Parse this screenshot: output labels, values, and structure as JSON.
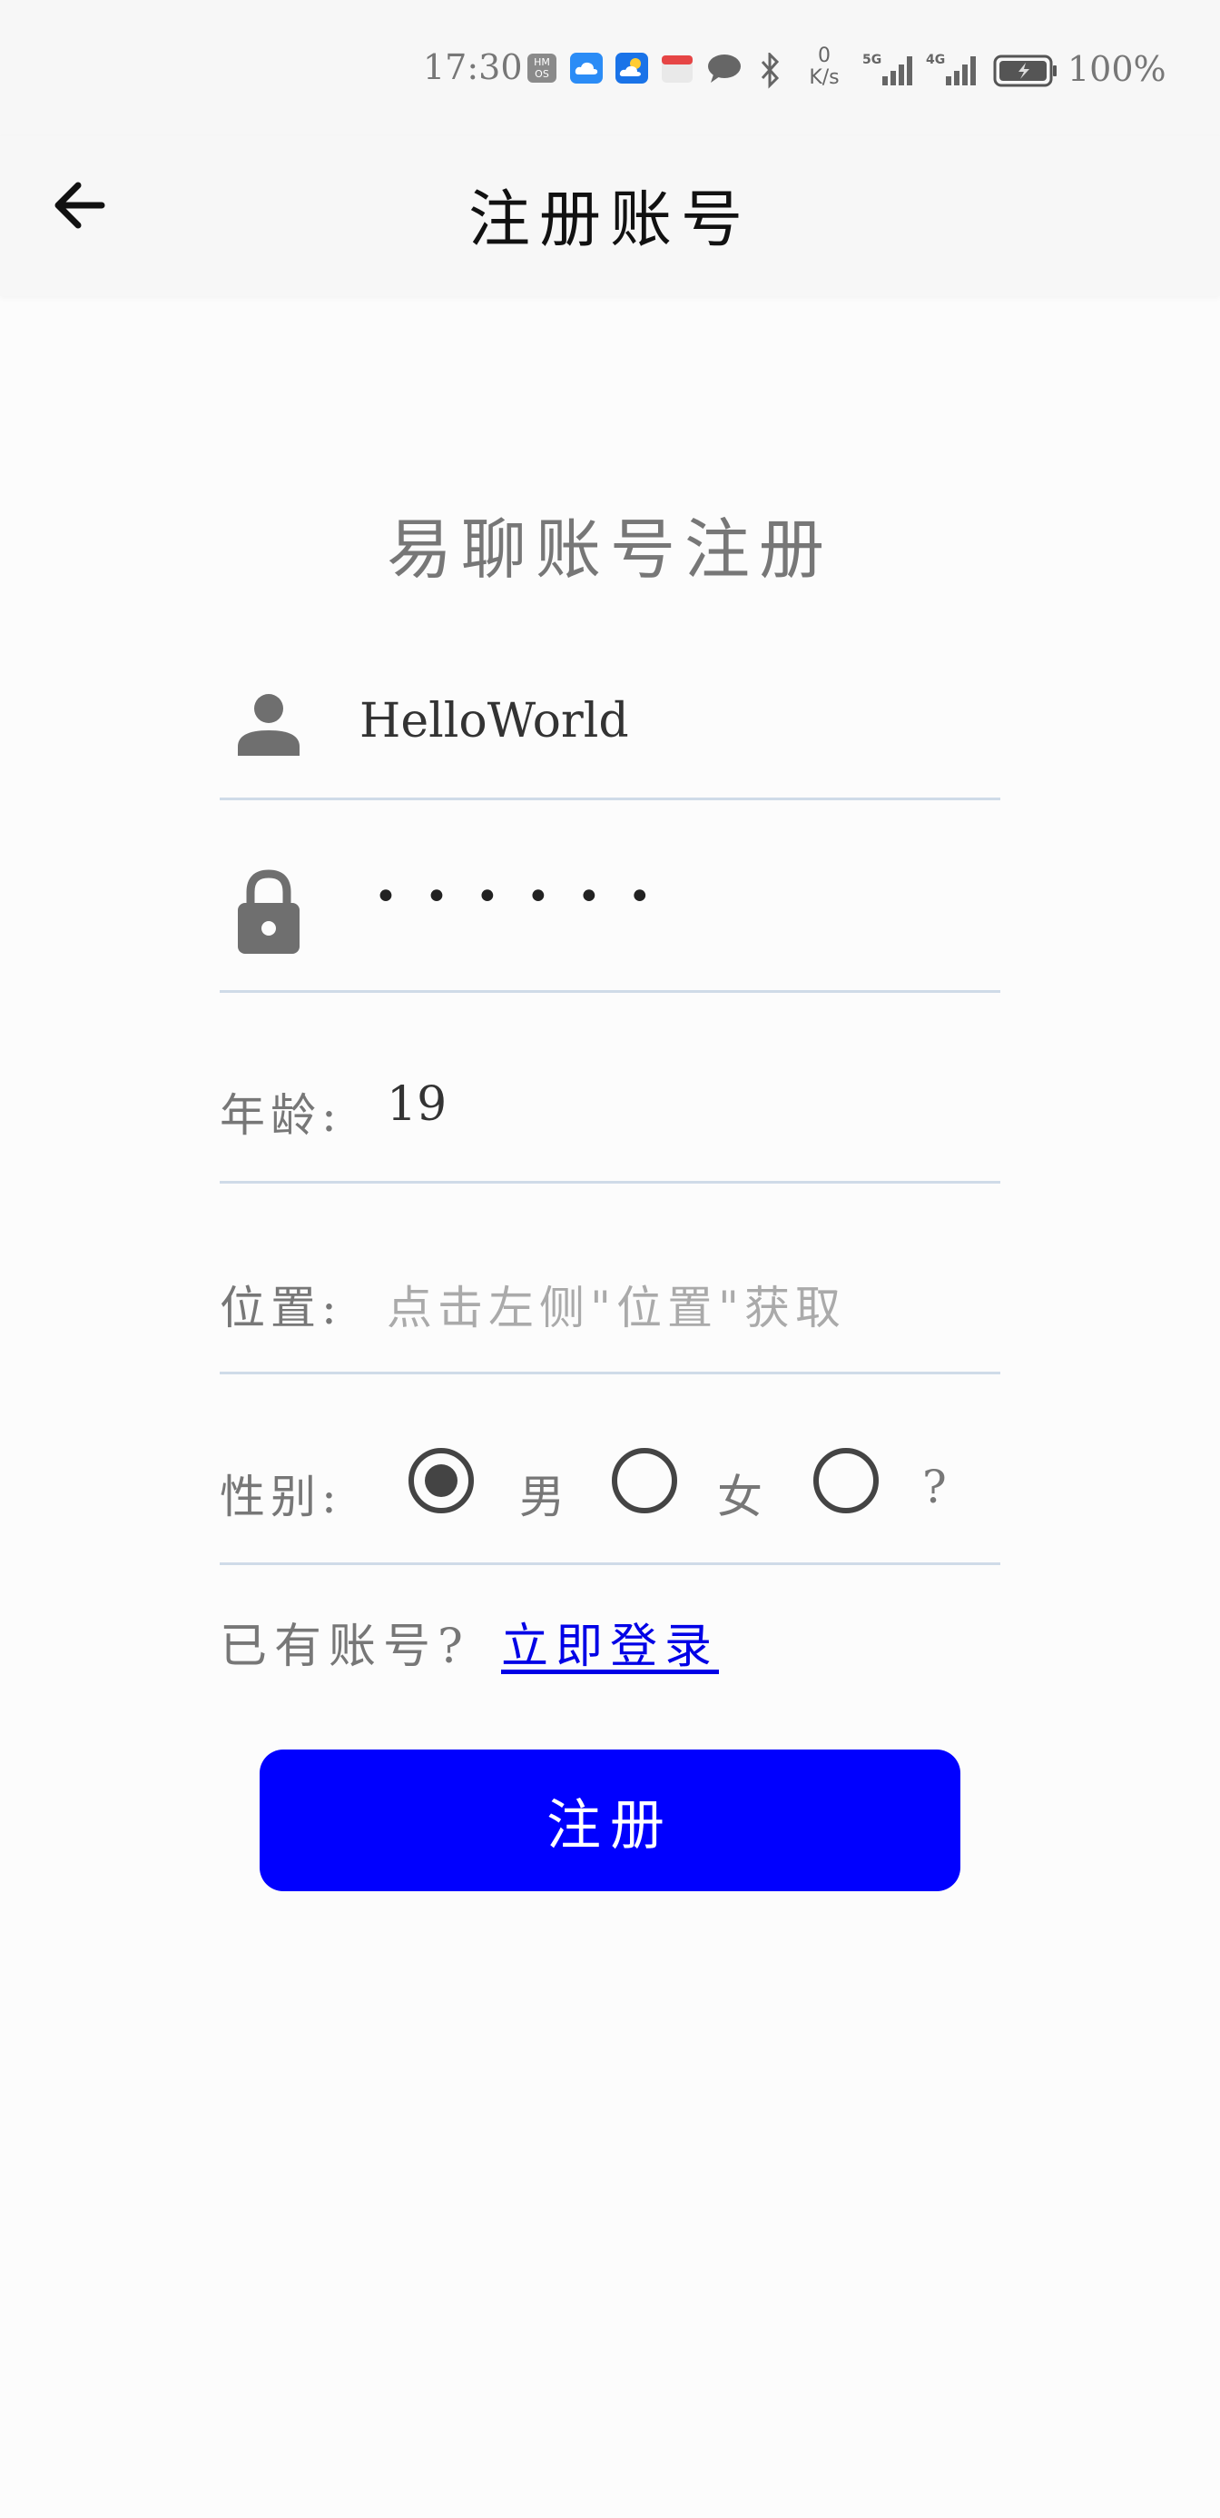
{
  "status_bar": {
    "time": "17:30",
    "net_speed_value": "0",
    "net_speed_unit": "K/s",
    "signal_1": "5G",
    "signal_2": "4G",
    "battery": "100%",
    "icons": [
      "hmos-icon",
      "cloud-icon",
      "weather-icon",
      "calendar-icon",
      "message-icon",
      "bluetooth-icon",
      "signal-icon",
      "signal-icon",
      "battery-icon"
    ]
  },
  "app_bar": {
    "title": "注册账号",
    "back_icon": "arrow-left-icon"
  },
  "form": {
    "heading": "易聊账号注册",
    "username": {
      "icon": "person-icon",
      "value": "HelloWorld"
    },
    "password": {
      "icon": "lock-icon",
      "masked": "••••••"
    },
    "age": {
      "label": "年龄:",
      "value": "19"
    },
    "location": {
      "label": "位置:",
      "placeholder": "点击左侧\"位置\"获取"
    },
    "gender": {
      "label": "性别:",
      "options": [
        {
          "label": "男",
          "selected": true
        },
        {
          "label": "女",
          "selected": false
        },
        {
          "label": "?",
          "selected": false
        }
      ]
    },
    "login_prompt": "已有账号?",
    "login_link": "立即登录",
    "register_button": "注册"
  },
  "colors": {
    "accent": "#0000ff",
    "link": "#0000e6",
    "divider": "#cfdbe8",
    "icon": "#6f6f6f"
  }
}
